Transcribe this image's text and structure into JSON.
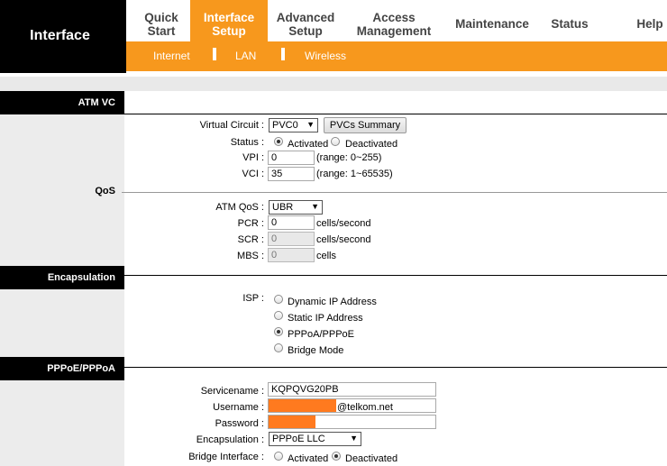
{
  "brand": "Interface",
  "nav": [
    {
      "line1": "Quick",
      "line2": "Start"
    },
    {
      "line1": "Interface",
      "line2": "Setup"
    },
    {
      "line1": "Advanced",
      "line2": "Setup"
    },
    {
      "line1": "Access",
      "line2": "Management"
    },
    {
      "line1": "Maintenance",
      "line2": ""
    },
    {
      "line1": "Status",
      "line2": ""
    },
    {
      "line1": "Help",
      "line2": ""
    }
  ],
  "subnav": [
    "Internet",
    "LAN",
    "Wireless"
  ],
  "sections": {
    "atm_vc": "ATM VC",
    "qos": "QoS",
    "encapsulation": "Encapsulation",
    "pppoe": "PPPoE/PPPoA"
  },
  "atm": {
    "virtual_circuit_label": "Virtual Circuit :",
    "virtual_circuit_value": "PVC0",
    "pvcs_summary_button": "PVCs Summary",
    "status_label": "Status :",
    "status_activated": "Activated",
    "status_deactivated": "Deactivated",
    "status_selected": "Activated",
    "vpi_label": "VPI :",
    "vpi_value": "0",
    "vpi_range": "(range: 0~255)",
    "vci_label": "VCI :",
    "vci_value": "35",
    "vci_range": "(range: 1~65535)"
  },
  "qos": {
    "atm_qos_label": "ATM QoS :",
    "atm_qos_value": "UBR",
    "pcr_label": "PCR :",
    "pcr_value": "0",
    "pcr_unit": "cells/second",
    "scr_label": "SCR :",
    "scr_value": "0",
    "scr_unit": "cells/second",
    "mbs_label": "MBS :",
    "mbs_value": "0",
    "mbs_unit": "cells"
  },
  "isp": {
    "label": "ISP :",
    "options": [
      "Dynamic IP Address",
      "Static IP Address",
      "PPPoA/PPPoE",
      "Bridge Mode"
    ],
    "selected": "PPPoA/PPPoE"
  },
  "pppoe": {
    "servicename_label": "Servicename :",
    "servicename_value": "KQPQVG20PB",
    "username_label": "Username :",
    "username_suffix": "@telkom.net",
    "password_label": "Password :",
    "encapsulation_label": "Encapsulation :",
    "encapsulation_value": "PPPoE LLC",
    "bridge_label": "Bridge Interface :",
    "bridge_activated": "Activated",
    "bridge_deactivated": "Deactivated",
    "bridge_selected": "Deactivated"
  },
  "colors": {
    "accent": "#f7981d",
    "redaction": "#ff7a1f"
  }
}
